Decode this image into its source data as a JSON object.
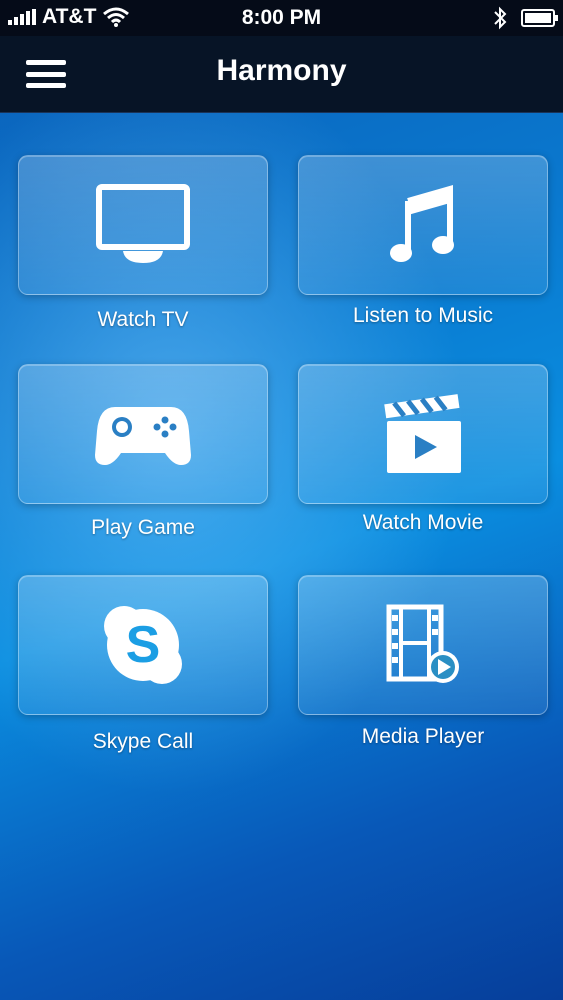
{
  "status_bar": {
    "carrier": "AT&T",
    "time": "8:00 PM"
  },
  "header": {
    "title": "Harmony"
  },
  "activities": [
    {
      "label": "Watch TV",
      "icon": "tv-icon"
    },
    {
      "label": "Listen to Music",
      "icon": "music-note-icon"
    },
    {
      "label": "Play Game",
      "icon": "gamepad-icon"
    },
    {
      "label": "Watch Movie",
      "icon": "clapperboard-icon"
    },
    {
      "label": "Skype Call",
      "icon": "skype-icon"
    },
    {
      "label": "Media Player",
      "icon": "film-strip-play-icon"
    }
  ],
  "colors": {
    "header_bg": "#071426",
    "background": "#0a7ad0",
    "skype_blue": "#1b9ee4"
  }
}
